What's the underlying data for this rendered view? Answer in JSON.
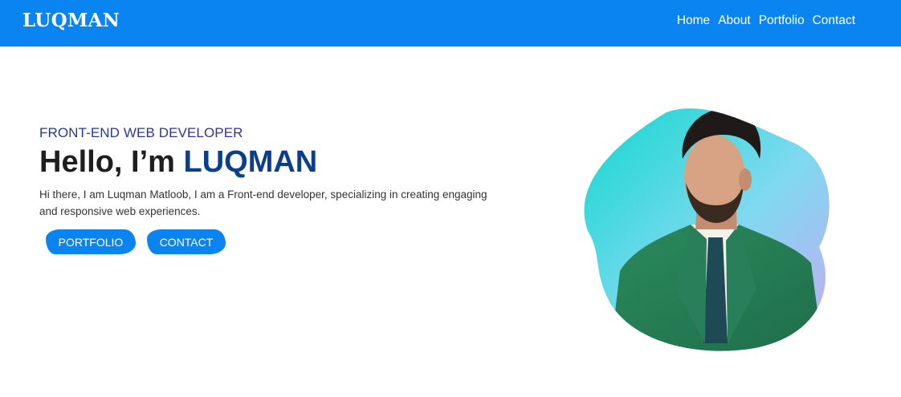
{
  "header": {
    "logo": "LUQMAN",
    "nav": [
      "Home",
      "About",
      "Portfolio",
      "Contact"
    ]
  },
  "hero": {
    "subtitle": "FRONT-END WEB DEVELOPER",
    "greeting": "Hello, I’m",
    "name": "LUQMAN",
    "intro": "Hi there, I am Luqman Matloob, I am a Front-end developer, specializing in creating engaging and responsive web experiences.",
    "buttons": {
      "portfolio": "PORTFOLIO",
      "contact": "CONTACT"
    }
  },
  "colors": {
    "primary": "#0a84f0",
    "name_accent": "#0a3f8c",
    "blob_teal": "#12d8cf",
    "blob_purple": "#c9a8f2"
  },
  "image": {
    "description_icon": "profile-portrait"
  }
}
